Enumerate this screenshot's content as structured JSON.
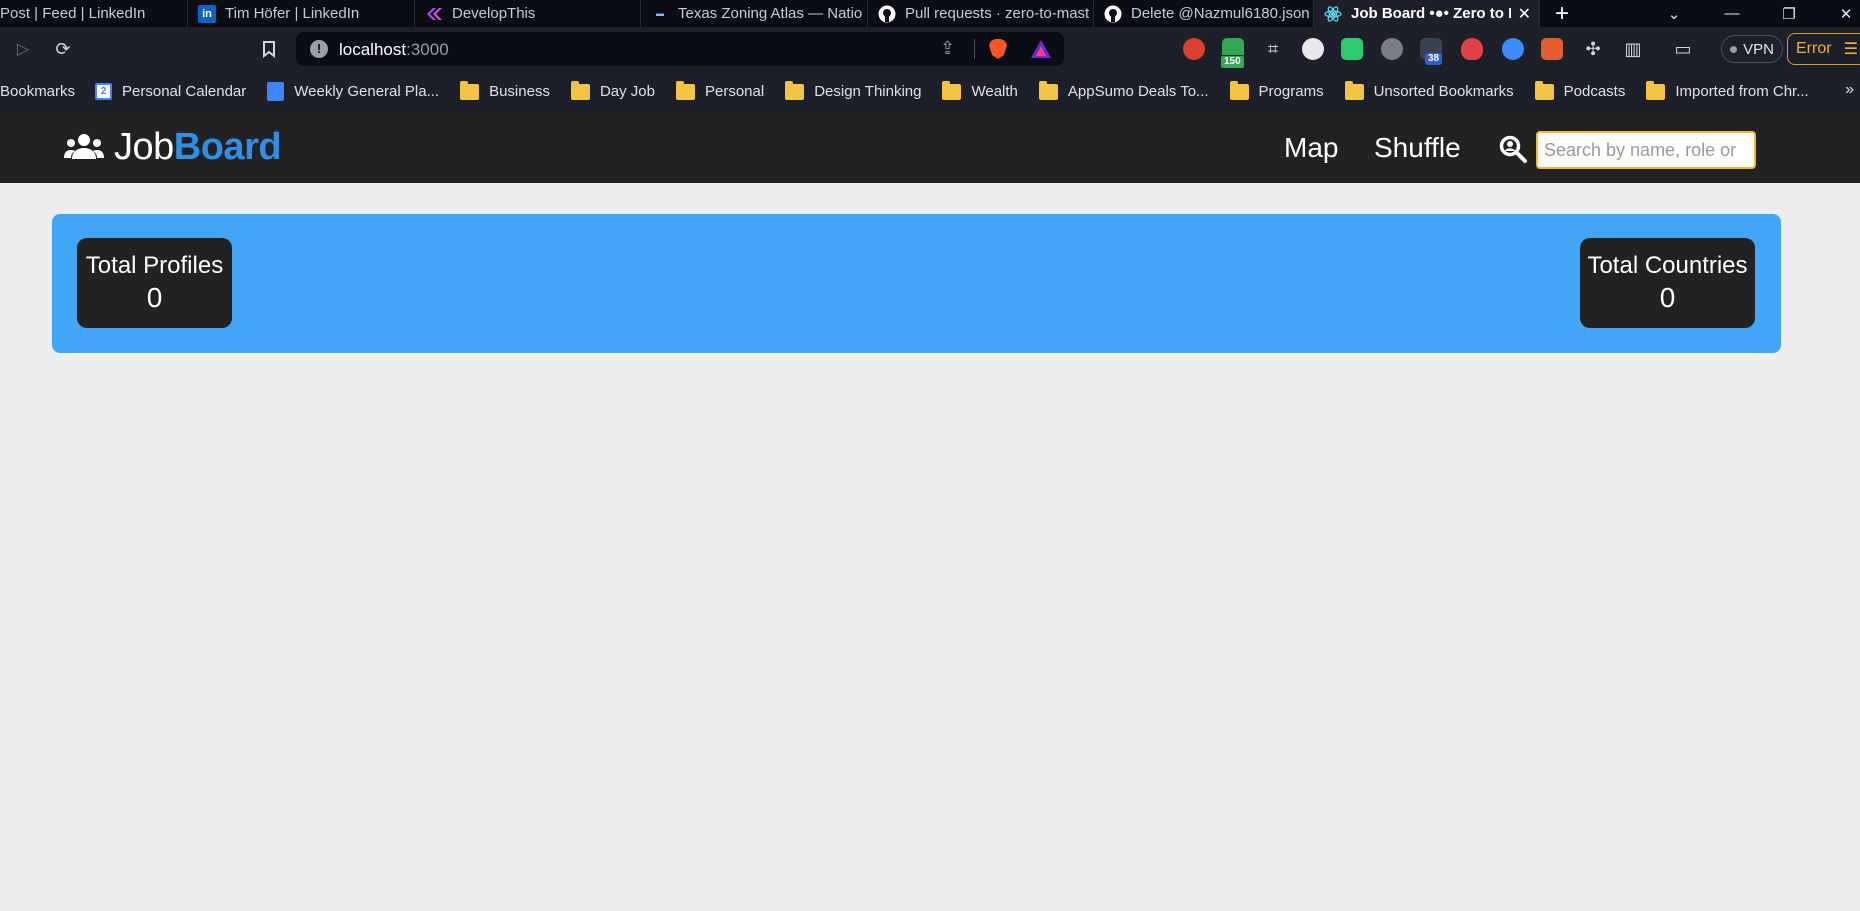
{
  "browser": {
    "tabs": [
      {
        "title": "Post | Feed | LinkedIn",
        "icon": "linkedin-icon"
      },
      {
        "title": "Tim Höfer | LinkedIn",
        "icon": "linkedin-icon"
      },
      {
        "title": "DevelopThis",
        "icon": "developthis-icon"
      },
      {
        "title": "Texas Zoning Atlas — Natio",
        "icon": "nza-icon"
      },
      {
        "title": "Pull requests · zero-to-mast",
        "icon": "github-icon"
      },
      {
        "title": "Delete @Nazmul6180.json",
        "icon": "github-icon"
      },
      {
        "title": "Job Board •●• Zero to M",
        "icon": "react-icon"
      }
    ],
    "address": {
      "host": "localhost",
      "port": ":3000"
    },
    "extension_badges": {
      "first": "150",
      "second": "38"
    },
    "vpn_label": "VPN",
    "error_label": "Error",
    "bookmarks": [
      {
        "label": "Bookmarks",
        "icon": "none"
      },
      {
        "label": "Personal Calendar",
        "icon": "calendar-icon"
      },
      {
        "label": "Weekly General Pla...",
        "icon": "doc-icon"
      },
      {
        "label": "Business",
        "icon": "folder-icon"
      },
      {
        "label": "Day Job",
        "icon": "folder-icon"
      },
      {
        "label": "Personal",
        "icon": "folder-icon"
      },
      {
        "label": "Design Thinking",
        "icon": "folder-icon"
      },
      {
        "label": "Wealth",
        "icon": "folder-icon"
      },
      {
        "label": "AppSumo Deals To...",
        "icon": "folder-icon"
      },
      {
        "label": "Programs",
        "icon": "folder-icon"
      },
      {
        "label": "Unsorted Bookmarks",
        "icon": "folder-icon"
      },
      {
        "label": "Podcasts",
        "icon": "folder-icon"
      },
      {
        "label": "Imported from Chr...",
        "icon": "folder-icon"
      }
    ]
  },
  "app": {
    "brand": {
      "part1": "Job",
      "part2": "Board"
    },
    "nav": {
      "map": "Map",
      "shuffle": "Shuffle"
    },
    "search": {
      "placeholder": "Search by name, role or"
    },
    "stats": {
      "profiles": {
        "label": "Total Profiles",
        "value": "0"
      },
      "countries": {
        "label": "Total Countries",
        "value": "0"
      }
    },
    "colors": {
      "navbar": "#222222",
      "accent": "#2d8fe8",
      "panel": "#42a5f5",
      "search_border": "#f5b82e"
    }
  }
}
